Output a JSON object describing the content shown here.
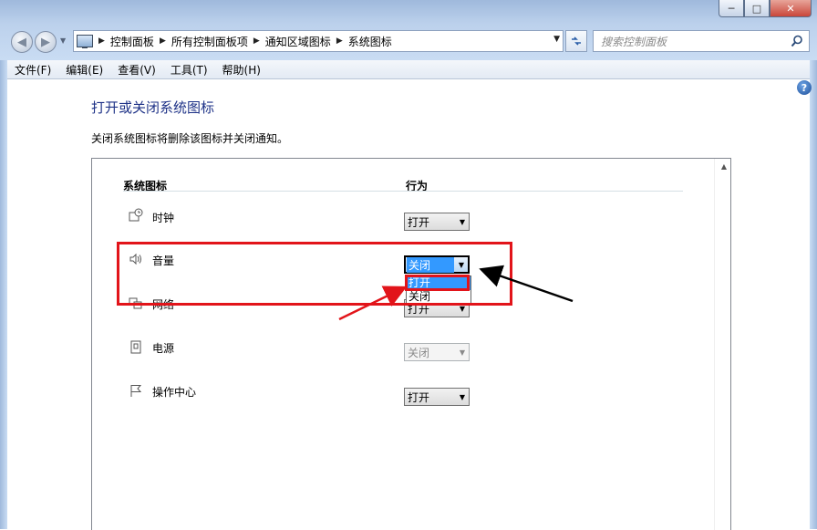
{
  "window": {
    "controls": {
      "minimize": "─",
      "maximize": "□",
      "close": "✕"
    }
  },
  "nav": {
    "back_icon": "back-arrow-icon",
    "forward_icon": "forward-arrow-icon",
    "breadcrumb": [
      "控制面板",
      "所有控制面板项",
      "通知区域图标",
      "系统图标"
    ],
    "search_placeholder": "搜索控制面板"
  },
  "menubar": {
    "items": [
      "文件(F)",
      "编辑(E)",
      "查看(V)",
      "工具(T)",
      "帮助(H)"
    ]
  },
  "help": {
    "glyph": "?"
  },
  "page": {
    "title": "打开或关闭系统图标",
    "description": "关闭系统图标将删除该图标并关闭通知。"
  },
  "table": {
    "col_icon": "系统图标",
    "col_behavior": "行为",
    "rows": [
      {
        "label": "时钟",
        "value": "打开",
        "state": "normal",
        "icon": "clock-icon"
      },
      {
        "label": "音量",
        "value": "关闭",
        "state": "focused",
        "icon": "speaker-icon"
      },
      {
        "label": "网络",
        "value": "打开",
        "state": "normal",
        "icon": "network-icon"
      },
      {
        "label": "电源",
        "value": "关闭",
        "state": "disabled",
        "icon": "power-icon"
      },
      {
        "label": "操作中心",
        "value": "打开",
        "state": "normal",
        "icon": "flag-icon"
      }
    ],
    "dropdown_options": [
      "打开",
      "关闭"
    ],
    "dropdown_highlighted": "打开"
  },
  "colors": {
    "title_blue": "#1e3287",
    "annotation_red": "#e2141a",
    "selection_blue": "#3399ff"
  }
}
